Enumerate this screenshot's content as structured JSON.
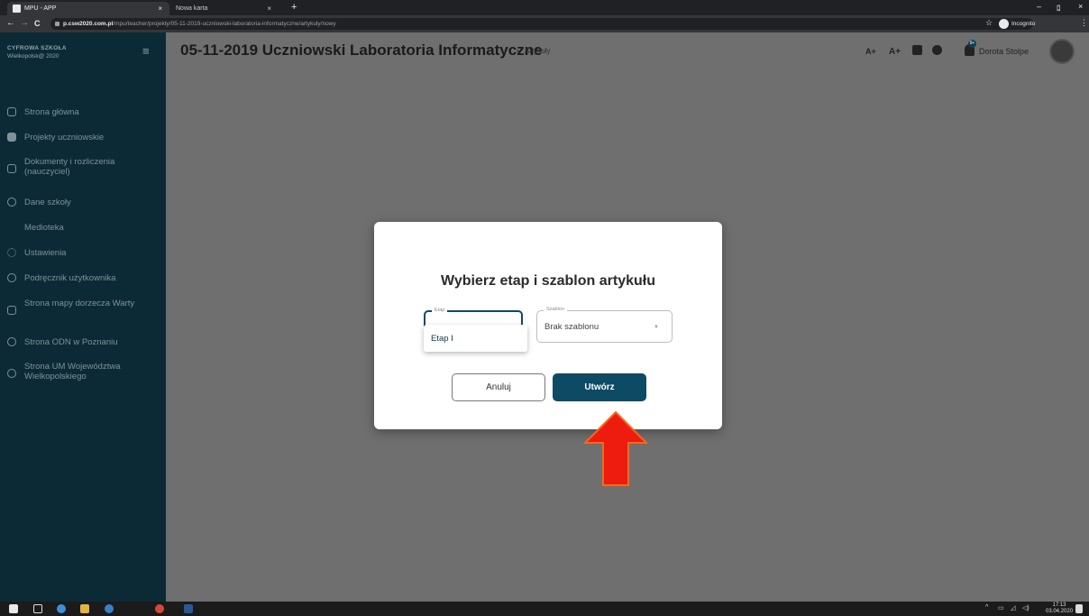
{
  "browser": {
    "tabs": [
      {
        "title": "MPU - APP",
        "close": "×"
      },
      {
        "title": "Nowa karta",
        "close": "×"
      }
    ],
    "new_tab": "+",
    "window_controls": {
      "minimize": "–",
      "restore": "ﾛ",
      "close": "×"
    },
    "nav": {
      "back": "←",
      "forward": "→",
      "reload": "C"
    },
    "url_host": "p.csw2020.com.pl",
    "url_path": "/mpu/teacher/projekty/05-11-2019-uczniowski-laboratoria-informatyczne/artykuly/nowy",
    "star": "☆",
    "incognito_label": "Incognito",
    "menu": "⋮"
  },
  "brand": {
    "line1": "CYFROWA SZKOŁA",
    "line2": "Wielkopolsk@ 2020",
    "menu_icon": "≡"
  },
  "header": {
    "title": "05-11-2019 Uczniowski Laboratoria Informatyczne",
    "breadcrumb_separator": "•",
    "breadcrumb": "Artykuły",
    "font_larger": "A+",
    "font_largest": "A+",
    "notification_count": "9+",
    "user_name": "Dorota Stolpe"
  },
  "sidebar": {
    "items": [
      {
        "label": "Strona główna"
      },
      {
        "label": "Projekty uczniowskie"
      },
      {
        "label": "Dokumenty i rozliczenia (nauczyciel)"
      },
      {
        "label": "Dane szkoły"
      },
      {
        "label": "Medioteka"
      },
      {
        "label": "Ustawienia"
      },
      {
        "label": "Podręcznik użytkownika"
      },
      {
        "label": "Strona mapy dorzecza Warty"
      },
      {
        "label": "Strona ODN w Poznaniu"
      },
      {
        "label": "Strona UM Województwa Wielkopolskiego"
      }
    ]
  },
  "modal": {
    "title": "Wybierz etap i szablon artykułu",
    "etap_label": "Etap",
    "etap_option": "Etap I",
    "szablon_label": "Szablon",
    "szablon_value": "Brak szablonu",
    "cancel": "Anuluj",
    "create": "Utwórz"
  },
  "taskbar": {
    "time": "17:13",
    "date": "03.04.2020"
  },
  "colors": {
    "sidebar": "#0c2a36",
    "accent": "#0d4a64",
    "overlay": "#6f6f6f",
    "arrow": "#ee1c0e"
  }
}
